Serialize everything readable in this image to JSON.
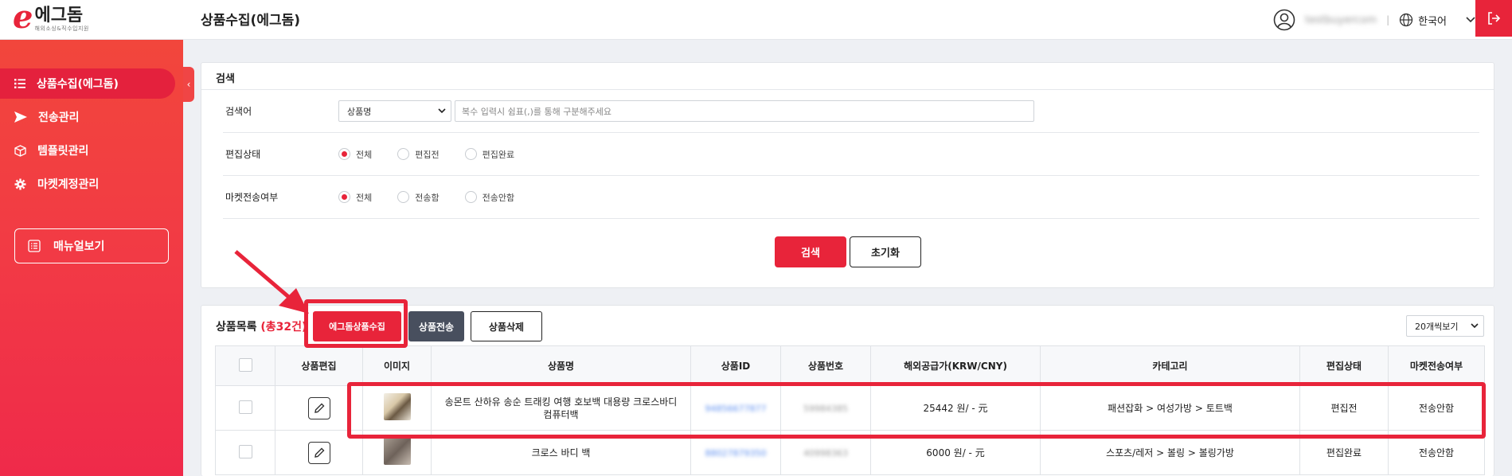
{
  "header": {
    "logo_mark": "e",
    "logo_title": "에그돔",
    "logo_sub": "해외소싱&직수입지원",
    "page_title": "상품수집(에그돔)",
    "user_name": "testbuyercom",
    "separator": "|",
    "language": "한국어"
  },
  "sidebar": {
    "items": [
      {
        "label": "상품수집(에그돔)",
        "icon": "list-icon",
        "active": true
      },
      {
        "label": "전송관리",
        "icon": "send-icon"
      },
      {
        "label": "템플릿관리",
        "icon": "box-icon"
      },
      {
        "label": "마켓계정관리",
        "icon": "gear-icon"
      }
    ],
    "manual_label": "매뉴얼보기",
    "collapse_glyph": "‹"
  },
  "search": {
    "title": "검색",
    "keyword_label": "검색어",
    "keyword_select": "상품명",
    "keyword_placeholder": "복수 입력시 쉼표(,)를 통해 구분해주세요",
    "edit_status_label": "편집상태",
    "edit_status_options": [
      "전체",
      "편집전",
      "편집완료"
    ],
    "market_label": "마켓전송여부",
    "market_options": [
      "전체",
      "전송함",
      "전송안함"
    ],
    "search_button": "검색",
    "reset_button": "초기화"
  },
  "list": {
    "title": "상품목록",
    "count": "(총32건)",
    "collect_button": "에그돔상품수집",
    "send_button": "상품전송",
    "delete_button": "상품삭제",
    "page_size": "20개씩보기",
    "columns": [
      "상품편집",
      "이미지",
      "상품명",
      "상품ID",
      "상품번호",
      "해외공급가(KRW/CNY)",
      "카테고리",
      "편집상태",
      "마켓전송여부"
    ],
    "rows": [
      {
        "name": "송몬트 산하유 송순 트래킹 여행 호보백 대용량 크로스바디 컴퓨터백",
        "product_id": "94856677877",
        "product_no": "59984385",
        "price": "25442 원/ - 元",
        "category": "패션잡화 > 여성가방 > 토트백",
        "edit_status": "편집전",
        "market_status": "전송안함"
      },
      {
        "name": "크로스 바디 백",
        "product_id": "88027879350",
        "product_no": "40998363",
        "price": "6000 원/ - 元",
        "category": "스포츠/레저 > 볼링 > 볼링가방",
        "edit_status": "편집완료",
        "market_status": "전송안함"
      }
    ]
  },
  "colors": {
    "accent": "#e8243a",
    "sidebar_top": "#f2463c",
    "send_button": "#484f5e"
  }
}
